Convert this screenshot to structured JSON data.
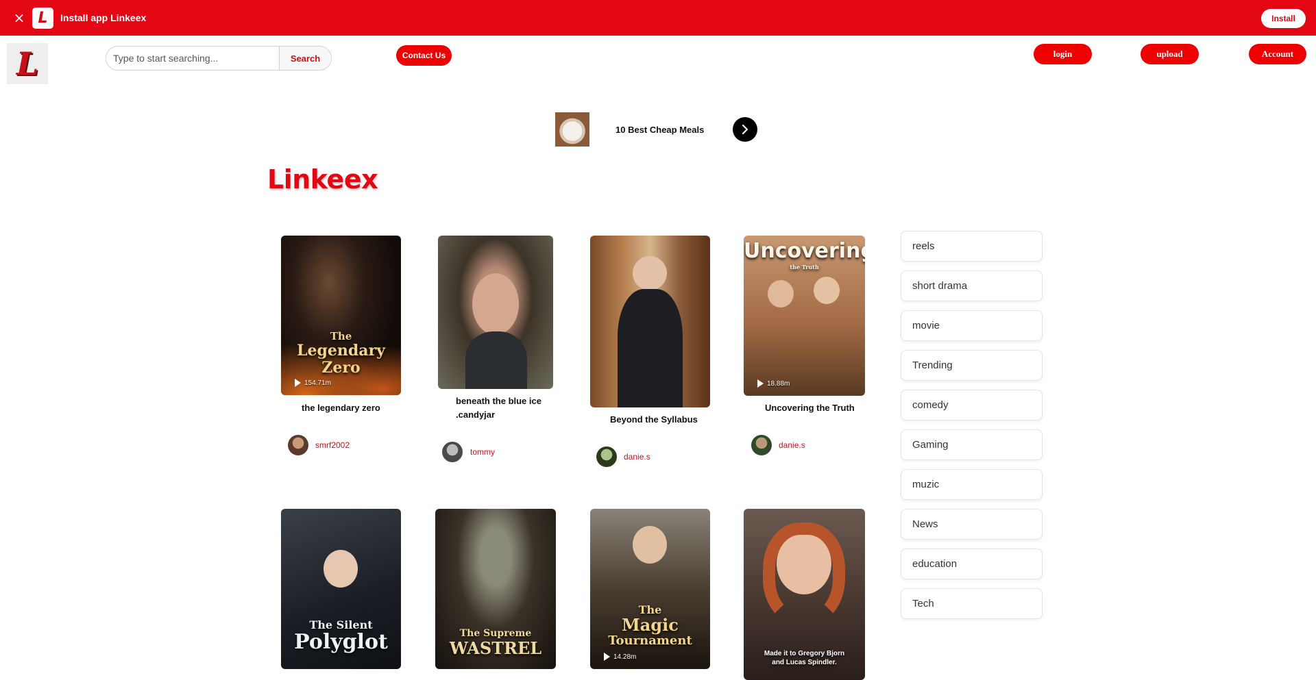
{
  "install_banner": {
    "logo_letter": "L",
    "title": "Install app Linkeex",
    "install_label": "Install",
    "close_symbol": "×"
  },
  "header": {
    "logo_letter": "L",
    "search": {
      "placeholder": "Type to start searching...",
      "button_label": "Search"
    },
    "contact_label": "Contact Us",
    "login_label": "login",
    "upload_label": "upload",
    "account_label": "Account"
  },
  "promo": {
    "title": "10 Best Cheap Meals",
    "icon": "chevron-right-icon"
  },
  "brand_heading": "Linkeex",
  "cards": [
    {
      "title": "the legendary zero",
      "poster_line1": "The",
      "poster_line2": "Legendary",
      "poster_line3": "Zero",
      "views": "154.71m",
      "author": "smrf2002"
    },
    {
      "title": "beneath the blue ice .candyjar",
      "poster_line1": "",
      "poster_line2": "",
      "poster_line3": "",
      "views": "",
      "author": "tommy"
    },
    {
      "title": "Beyond the Syllabus",
      "poster_line1": "",
      "poster_line2": "",
      "poster_line3": "",
      "views": "",
      "author": "danie.s"
    },
    {
      "title": "Uncovering the Truth",
      "poster_line1": "Uncovering",
      "poster_line2": "the Truth",
      "poster_line3": "",
      "views": "18.88m",
      "author": "danie.s"
    },
    {
      "title": "",
      "poster_line1": "The Silent",
      "poster_line2": "Polyglot",
      "poster_line3": "",
      "views": "",
      "author": ""
    },
    {
      "title": "",
      "poster_line1": "The Supreme",
      "poster_line2": "WASTREL",
      "poster_line3": "",
      "views": "",
      "author": ""
    },
    {
      "title": "",
      "poster_line1": "The",
      "poster_line2": "Magic",
      "poster_line3": "Tournament",
      "views": "14.28m",
      "author": ""
    },
    {
      "title": "",
      "poster_line1": "Made it to Gregory Bjorn",
      "poster_line2": "and Lucas Spindler.",
      "poster_line3": "",
      "views": "",
      "author": ""
    }
  ],
  "categories": [
    "reels",
    "short drama",
    "movie",
    "Trending",
    "comedy",
    "Gaming",
    "muzic",
    "News",
    "education",
    "Tech"
  ],
  "colors": {
    "brand_red": "#e30613",
    "author_red": "#c8101a",
    "button_red": "#ee0000"
  }
}
